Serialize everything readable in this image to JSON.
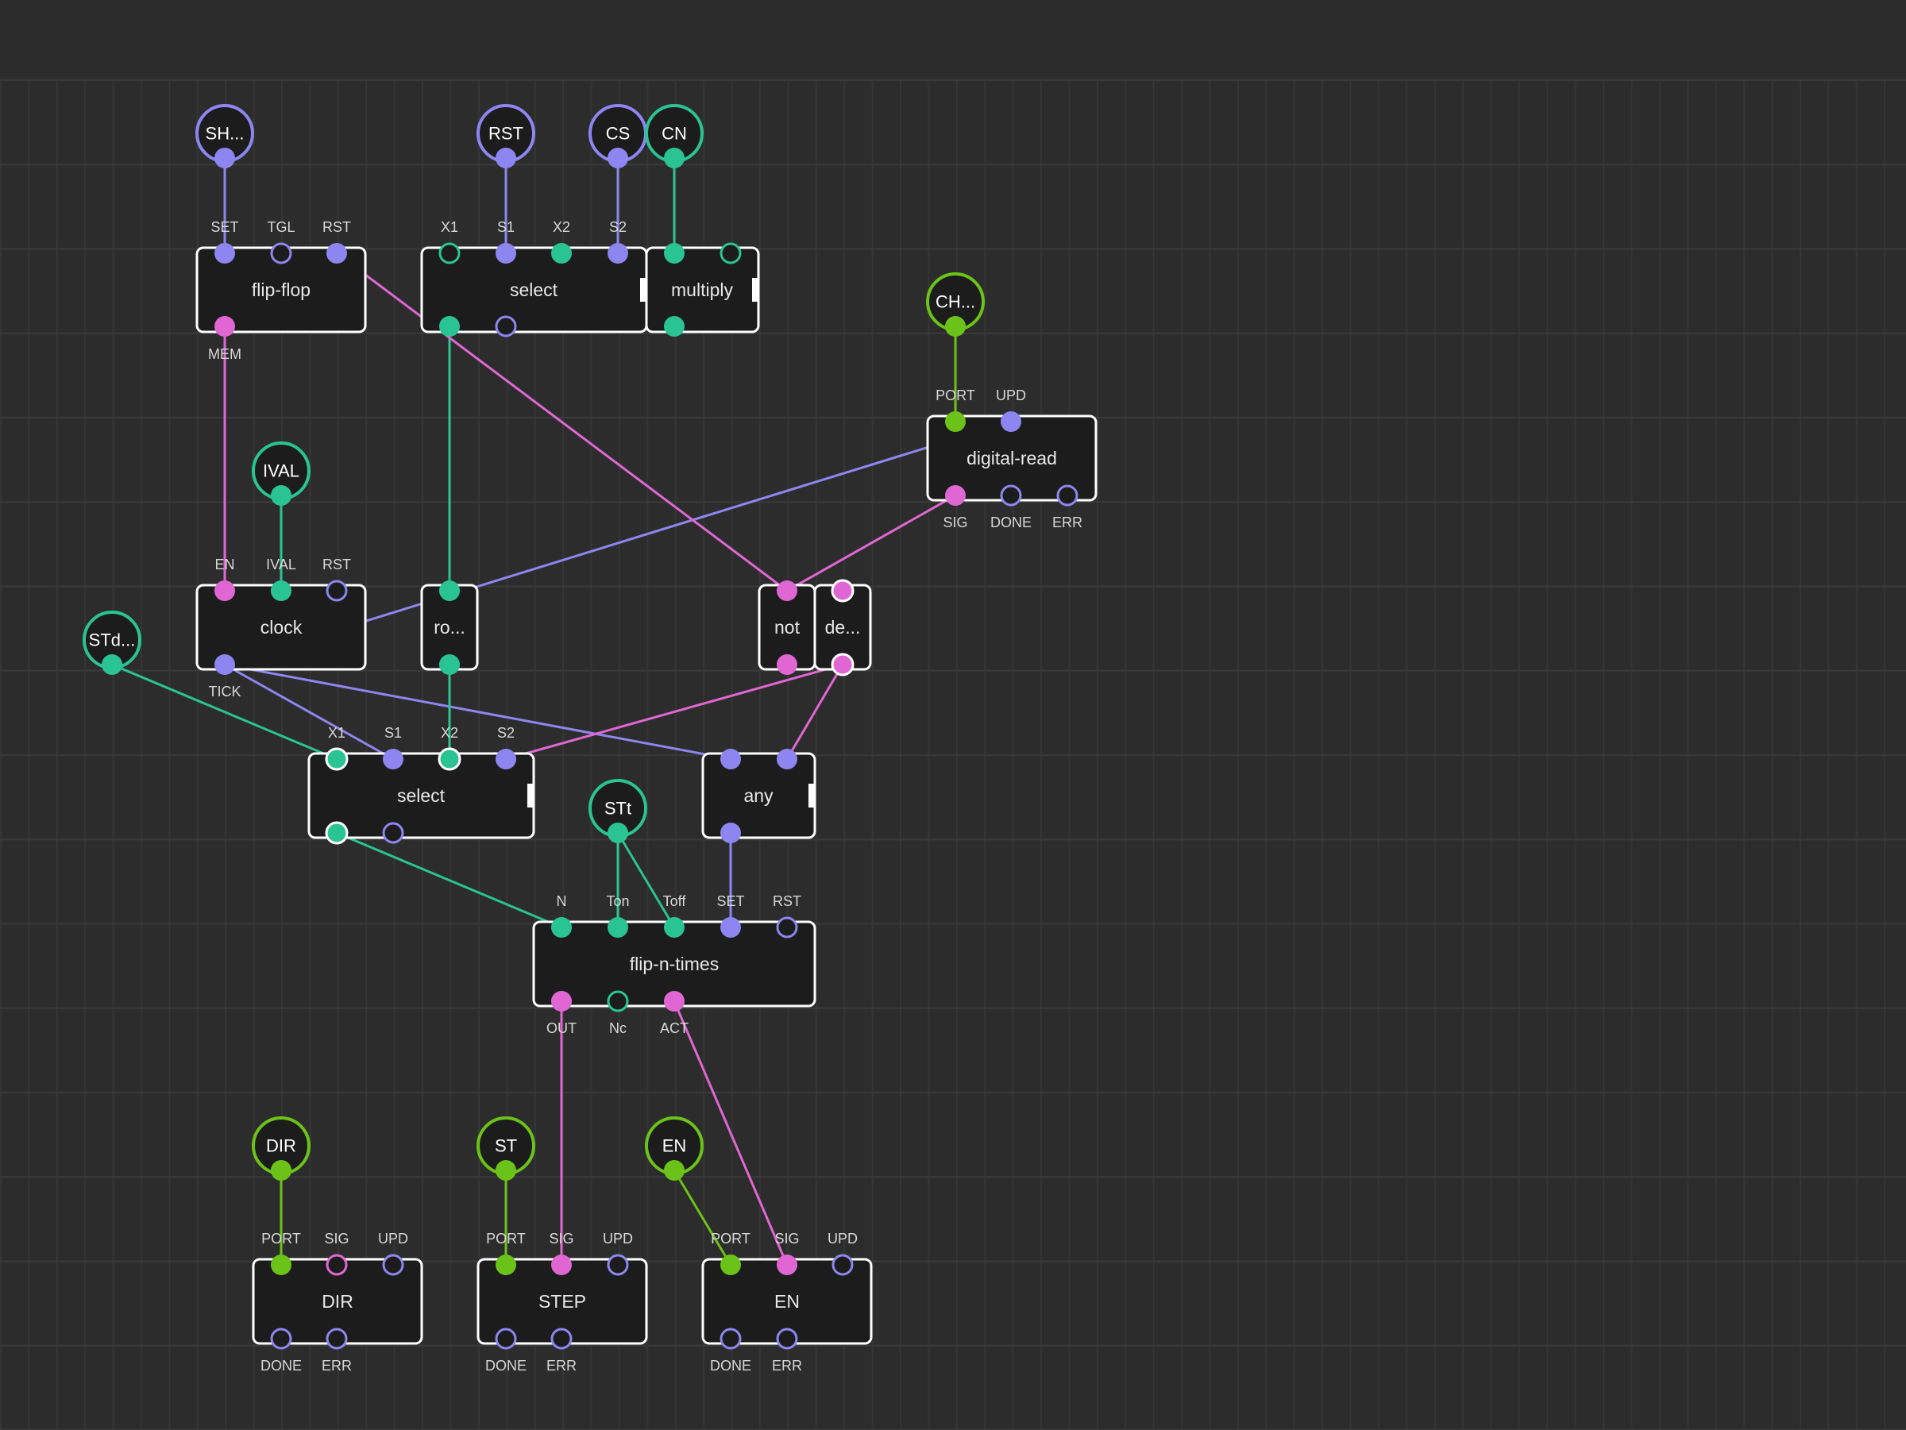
{
  "colors": {
    "background": "#2c2c2c",
    "node_fill": "#1c1c1c",
    "node_border": "#ffffff",
    "pulse": "#8e86f0",
    "number": "#2ac492",
    "boolean": "#e067d3",
    "port": "#6bc218"
  },
  "terminals": [
    {
      "name": "terminal-sh",
      "label": "SH...",
      "type": "pulse"
    },
    {
      "name": "terminal-rst",
      "label": "RST",
      "type": "pulse"
    },
    {
      "name": "terminal-cs",
      "label": "CS",
      "type": "pulse"
    },
    {
      "name": "terminal-cn",
      "label": "CN",
      "type": "number"
    },
    {
      "name": "terminal-ch",
      "label": "CH...",
      "type": "port"
    },
    {
      "name": "terminal-ival",
      "label": "IVAL",
      "type": "number"
    },
    {
      "name": "terminal-std",
      "label": "STd...",
      "type": "number"
    },
    {
      "name": "terminal-stt",
      "label": "STt",
      "type": "number"
    },
    {
      "name": "terminal-dir",
      "label": "DIR",
      "type": "port"
    },
    {
      "name": "terminal-st",
      "label": "ST",
      "type": "port"
    },
    {
      "name": "terminal-en",
      "label": "EN",
      "type": "port"
    }
  ],
  "nodes": [
    {
      "name": "node-flip-flop",
      "label": "flip-flop"
    },
    {
      "name": "node-select-top",
      "label": "select"
    },
    {
      "name": "node-multiply",
      "label": "multiply"
    },
    {
      "name": "node-digital-read",
      "label": "digital-read"
    },
    {
      "name": "node-clock",
      "label": "clock"
    },
    {
      "name": "node-round",
      "label": "ro..."
    },
    {
      "name": "node-not",
      "label": "not"
    },
    {
      "name": "node-defer",
      "label": "de..."
    },
    {
      "name": "node-select-mid",
      "label": "select"
    },
    {
      "name": "node-any",
      "label": "any"
    },
    {
      "name": "node-flip-n-times",
      "label": "flip-n-times"
    },
    {
      "name": "node-dir",
      "label": "DIR"
    },
    {
      "name": "node-step",
      "label": "STEP"
    },
    {
      "name": "node-en",
      "label": "EN"
    }
  ],
  "pin_labels": {
    "flip_flop": [
      "SET",
      "TGL",
      "RST",
      "MEM"
    ],
    "select_top": [
      "X1",
      "S1",
      "X2",
      "S2"
    ],
    "digital_read": [
      "PORT",
      "UPD",
      "SIG",
      "DONE",
      "ERR"
    ],
    "clock": [
      "EN",
      "IVAL",
      "RST",
      "TICK"
    ],
    "select_mid": [
      "X1",
      "S1",
      "X2",
      "S2"
    ],
    "flip_n_times": [
      "N",
      "Ton",
      "Toff",
      "SET",
      "RST",
      "OUT",
      "Nc",
      "ACT"
    ],
    "dir": [
      "PORT",
      "SIG",
      "UPD",
      "DONE",
      "ERR"
    ],
    "step": [
      "PORT",
      "SIG",
      "UPD",
      "DONE",
      "ERR"
    ],
    "en": [
      "PORT",
      "SIG",
      "UPD",
      "DONE",
      "ERR"
    ]
  }
}
